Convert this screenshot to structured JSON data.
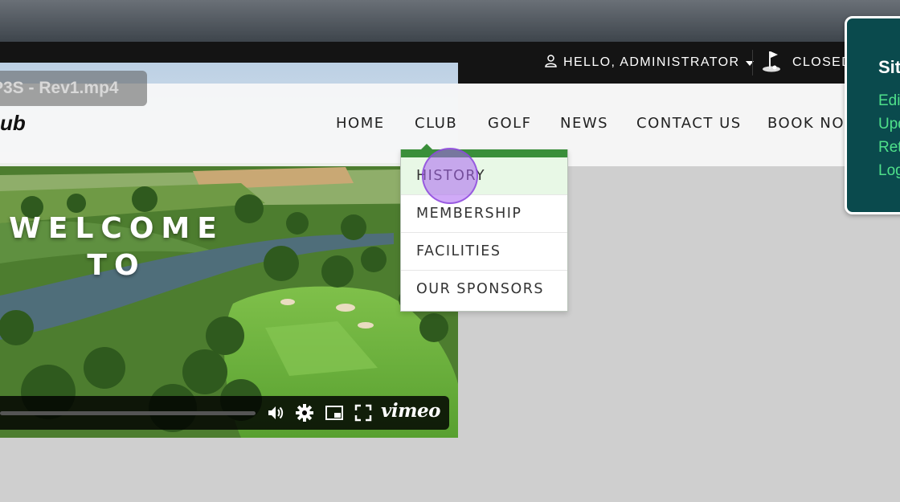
{
  "admin_bar": {
    "hello_label": "HELLO, ADMINISTRATOR",
    "closed_label": "CLOSED"
  },
  "video": {
    "title": "P3S - Rev1.mp4",
    "welcome_line1": "WELCOME",
    "welcome_line2": "TO",
    "brand": "vimeo"
  },
  "site": {
    "logo_fragment": "ub"
  },
  "nav": {
    "items": [
      "HOME",
      "CLUB",
      "GOLF",
      "NEWS",
      "CONTACT US",
      "BOOK NOW"
    ]
  },
  "club_dropdown": {
    "items": [
      "HISTORY",
      "MEMBERSHIP",
      "FACILITIES",
      "OUR SPONSORS"
    ],
    "active": "HISTORY"
  },
  "site_panel": {
    "title": "Site",
    "links": [
      "Edit",
      "Update",
      "Return",
      "Logout"
    ]
  },
  "colors": {
    "dropdown_accent": "#3a8f3a",
    "panel_bg": "#0a4a4d",
    "panel_link": "#4fe08a",
    "admin_bar_bg": "#141414"
  },
  "icons": {
    "user": "user-icon",
    "caret": "caret-down-icon",
    "flag": "golf-flag-icon",
    "volume": "volume-icon",
    "settings": "gear-icon",
    "pip": "picture-in-picture-icon",
    "fullscreen": "fullscreen-icon"
  }
}
